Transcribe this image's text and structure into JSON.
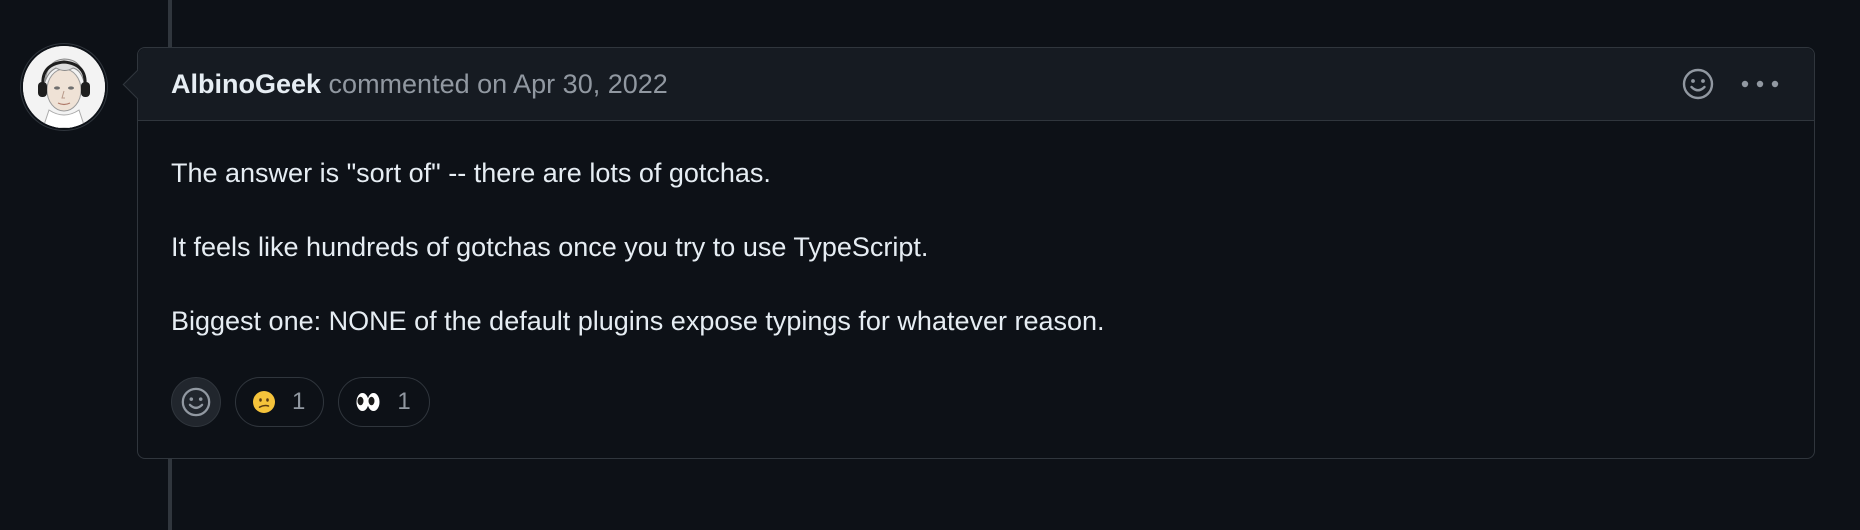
{
  "comment": {
    "author": "AlbinoGeek",
    "meta": "commented on Apr 30, 2022",
    "body": [
      "The answer is \"sort of\" -- there are lots of gotchas.",
      "It feels like hundreds of gotchas once you try to use TypeScript.",
      "Biggest one: NONE of the default plugins expose typings for whatever reason."
    ],
    "reactions": [
      {
        "emoji": "confused-face-icon",
        "count": "1"
      },
      {
        "emoji": "eyes-icon",
        "count": "1"
      }
    ]
  },
  "colors": {
    "background": "#0d1117",
    "header_background": "#161b22",
    "border": "#30363d",
    "text": "#e6edf3",
    "muted": "#9198a1"
  }
}
